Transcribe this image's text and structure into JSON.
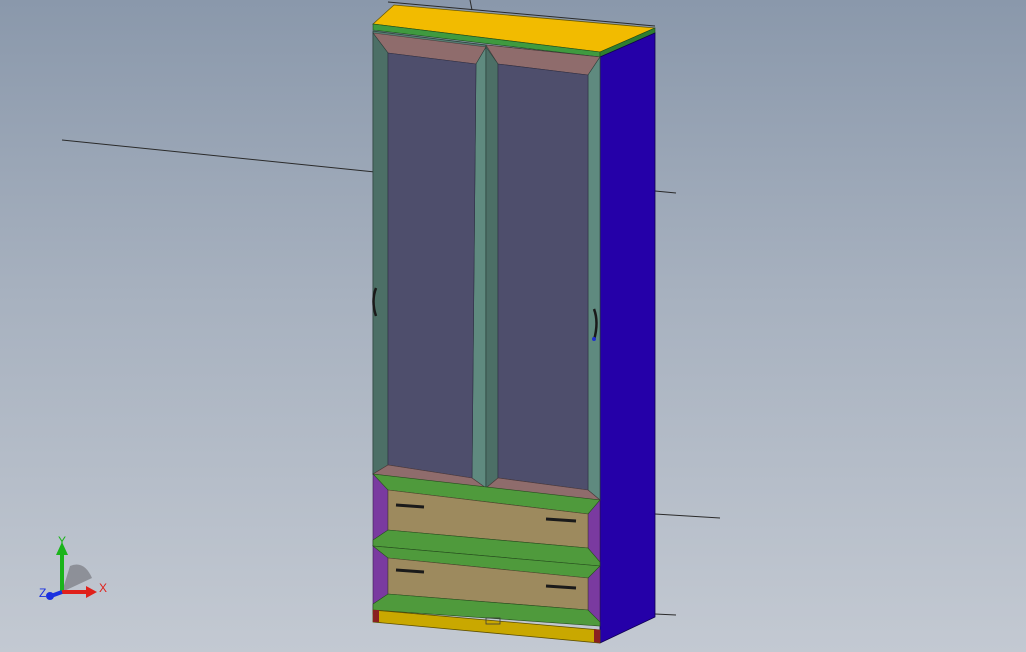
{
  "viewport": {
    "background_top": "#8a98ab",
    "background_bottom": "#c3c9d2"
  },
  "model": {
    "type": "cabinet",
    "parts": {
      "top_panel": "#f2bb00",
      "top_edge": "#3f9a3f",
      "side_panel": "#2500a8",
      "door_frame": "#557d72",
      "door_glass": "#4e4e6c",
      "door_moulding": "#8f6c6c",
      "drawer_front": "#9d8a5e",
      "drawer_rail": "#4f9a3c",
      "drawer_side": "#7a3aa0",
      "plinth": "#c9a800",
      "handle": "#1a1a1a"
    },
    "doors": [
      {
        "name": "left-door",
        "handle": "door-handle-left"
      },
      {
        "name": "right-door",
        "handle": "door-handle-right"
      }
    ],
    "drawers": [
      {
        "name": "upper-drawer"
      },
      {
        "name": "lower-drawer"
      }
    ]
  },
  "triad": {
    "x_label": "X",
    "y_label": "Y",
    "z_label": "Z",
    "x_color": "#e0201a",
    "y_color": "#1ab41a",
    "z_color": "#1a30e0"
  }
}
